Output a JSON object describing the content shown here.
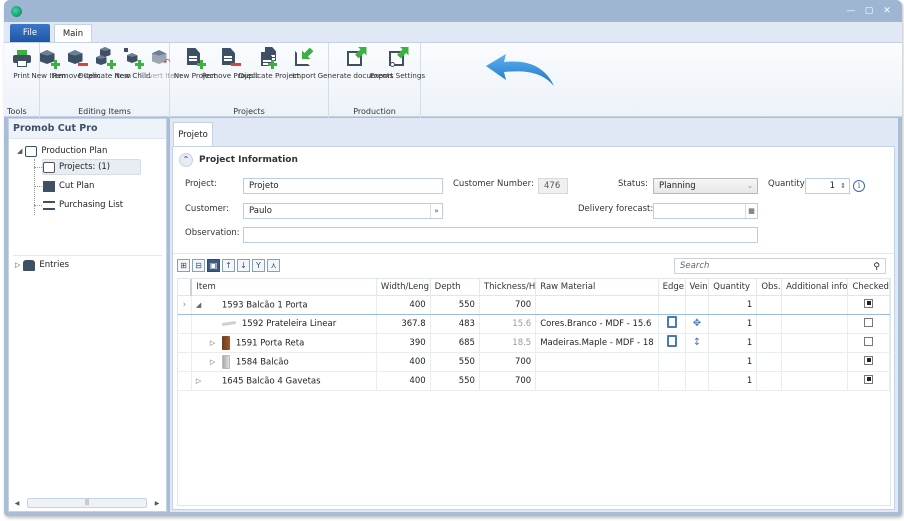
{
  "window": {
    "controls": [
      "minimize",
      "maximize",
      "close"
    ]
  },
  "menu_tabs": {
    "file": "File",
    "main": "Main"
  },
  "ribbon": {
    "groups": [
      {
        "label": "Tools",
        "buttons": [
          {
            "label": "Print",
            "icon": "printer-icon",
            "enabled": true
          }
        ]
      },
      {
        "label": "Editing Items",
        "buttons": [
          {
            "label": "New Item",
            "icon": "new-item-icon",
            "enabled": true
          },
          {
            "label": "Remove Item",
            "icon": "remove-item-icon",
            "enabled": true
          },
          {
            "label": "Duplicate Item",
            "icon": "duplicate-item-icon",
            "enabled": true
          },
          {
            "label": "New Child",
            "icon": "new-child-icon",
            "enabled": true
          },
          {
            "label": "Revert Item",
            "icon": "revert-item-icon",
            "enabled": false
          }
        ]
      },
      {
        "label": "Projects",
        "buttons": [
          {
            "label": "New Project",
            "icon": "new-project-icon",
            "enabled": true
          },
          {
            "label": "Remove Project",
            "icon": "remove-project-icon",
            "enabled": true
          },
          {
            "label": "Duplicate Project",
            "icon": "duplicate-project-icon",
            "enabled": true
          },
          {
            "label": "Import",
            "icon": "import-icon",
            "enabled": true
          }
        ]
      },
      {
        "label": "Production",
        "buttons": [
          {
            "label": "Generate documents",
            "icon": "generate-documents-icon",
            "enabled": true
          },
          {
            "label": "Export Settings",
            "icon": "export-settings-icon",
            "enabled": true
          }
        ]
      }
    ]
  },
  "left_panel": {
    "title": "Promob Cut Pro",
    "tree": {
      "root": "Production Plan",
      "children": [
        "Projects: (1)",
        "Cut Plan",
        "Purchasing List"
      ],
      "entries": "Entries"
    }
  },
  "document_tab": "Projeto",
  "project_info": {
    "header": "Project Information",
    "project_label": "Project:",
    "project_value": "Projeto",
    "customer_number_label": "Customer Number:",
    "customer_number_value": "476",
    "status_label": "Status:",
    "status_value": "Planning",
    "quantity_label": "Quantity:",
    "quantity_value": "1",
    "customer_label": "Customer:",
    "customer_value": "Paulo",
    "delivery_label": "Delivery forecast:",
    "delivery_value": "",
    "observation_label": "Observation:",
    "observation_value": ""
  },
  "grid_toolbar": {
    "buttons": [
      "expand-all",
      "collapse-all",
      "toggle-view",
      "move-up",
      "move-down",
      "merge",
      "split"
    ],
    "search_placeholder": "Search"
  },
  "grid": {
    "columns": [
      "Item",
      "Width/Leng",
      "Depth",
      "Thickness/H",
      "Raw Material",
      "Edge",
      "Vein",
      "Quantity",
      "Obs.",
      "Additional info",
      "Checked"
    ],
    "rows": [
      {
        "level": 0,
        "expander": "expanded",
        "current": true,
        "icon": "cabinet",
        "item": "1593  Balcão 1 Porta",
        "width": "400",
        "depth": "550",
        "thickness": "700",
        "thickness_dim": false,
        "raw_material": "",
        "edge": false,
        "vein": "",
        "quantity": "1",
        "obs": "",
        "additional": "",
        "checked": true
      },
      {
        "level": 1,
        "expander": "none",
        "current": false,
        "icon": "shelf",
        "item": "1592  Prateleira Linear",
        "width": "367.8",
        "depth": "483",
        "thickness": "15.6",
        "thickness_dim": true,
        "raw_material": "Cores.Branco - MDF - 15.6",
        "edge": true,
        "vein": "✥",
        "quantity": "1",
        "obs": "",
        "additional": "",
        "checked": false
      },
      {
        "level": 1,
        "expander": "collapsed",
        "current": false,
        "icon": "wood",
        "item": "1591  Porta Reta",
        "width": "390",
        "depth": "685",
        "thickness": "18.5",
        "thickness_dim": true,
        "raw_material": "Madeiras.Maple - MDF - 18",
        "edge": true,
        "vein": "↕",
        "quantity": "1",
        "obs": "",
        "additional": "",
        "checked": false
      },
      {
        "level": 1,
        "expander": "collapsed",
        "current": false,
        "icon": "grey",
        "item": "1584  Balcão",
        "width": "400",
        "depth": "550",
        "thickness": "700",
        "thickness_dim": false,
        "raw_material": "",
        "edge": false,
        "vein": "",
        "quantity": "1",
        "obs": "",
        "additional": "",
        "checked": true
      },
      {
        "level": 0,
        "expander": "collapsed",
        "current": false,
        "icon": "cabinet",
        "item": "1645  Balcão 4 Gavetas",
        "width": "400",
        "depth": "550",
        "thickness": "700",
        "thickness_dim": false,
        "raw_material": "",
        "edge": false,
        "vein": "",
        "quantity": "1",
        "obs": "",
        "additional": "",
        "checked": true
      }
    ]
  },
  "colors": {
    "titlebar": "#9fb6d3",
    "file_tab": "#2a64b4",
    "icon_dark": "#3d5064",
    "icon_green": "#3cb043",
    "icon_red": "#d9443a",
    "callout_arrow": "#2f8fdc"
  }
}
